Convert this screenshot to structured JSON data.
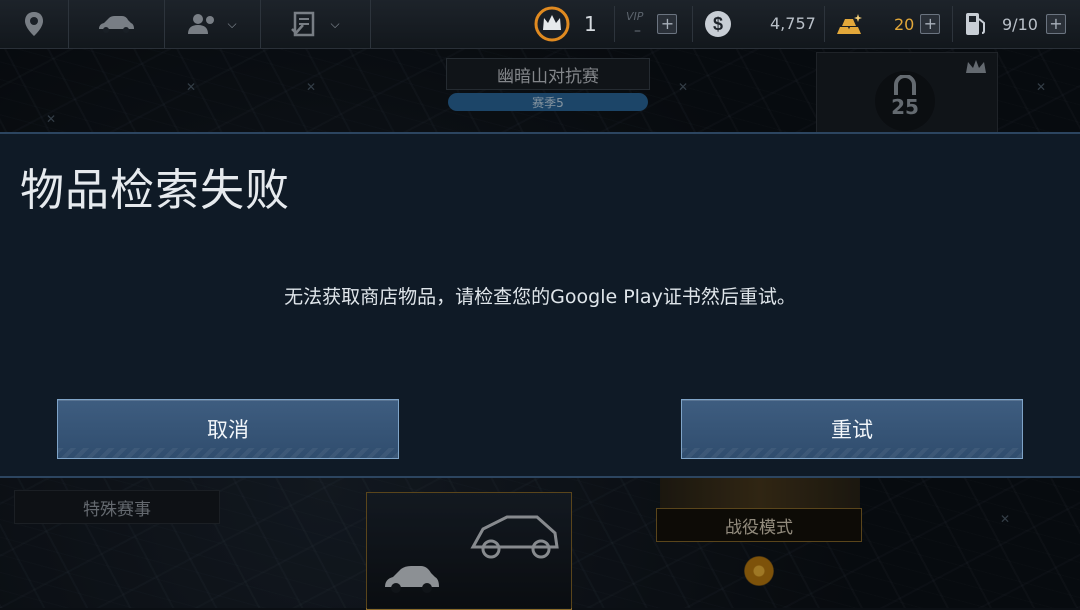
{
  "topbar": {
    "nav_icons": [
      "map-pin-icon",
      "car-icon",
      "users-icon",
      "checklist-icon"
    ],
    "crown_count": "1",
    "vip_label": "VIP",
    "vip_value": "–",
    "cash": "4,757",
    "gold": "20",
    "fuel": "9/10"
  },
  "event": {
    "title": "幽暗山对抗赛",
    "season": "赛季5",
    "lock_level": "25"
  },
  "dialog": {
    "title": "物品检索失败",
    "message": "无法获取商店物品，请检查您的Google Play证书然后重试。",
    "cancel_label": "取消",
    "retry_label": "重试"
  },
  "bottom": {
    "special_events_label": "特殊赛事",
    "campaign_label": "战役模式"
  },
  "colors": {
    "dialog_bg": "#0f1a26",
    "button_bg": "#3e5d80",
    "gold_text": "#e3a83a",
    "campaign_border": "#8a6a2a"
  }
}
